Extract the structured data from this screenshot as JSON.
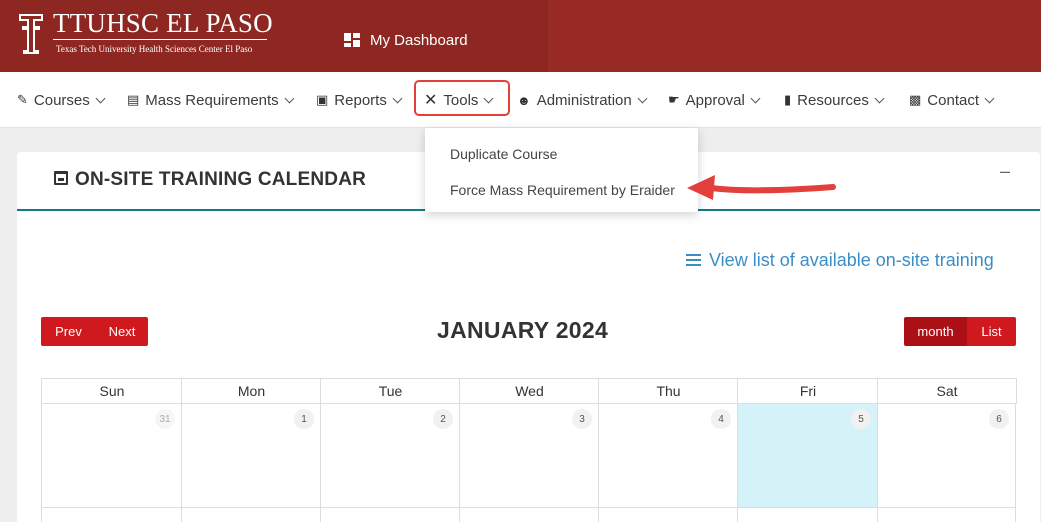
{
  "header": {
    "brand_title": "TTUHSC EL PASO",
    "brand_subtitle": "Texas Tech University Health Sciences Center El Paso",
    "dashboard_label": "My Dashboard",
    "colors": {
      "primary": "#8e2722",
      "accent": "#d0181f"
    }
  },
  "nav": {
    "items": [
      {
        "label": "Courses",
        "icon": "book-icon"
      },
      {
        "label": "Mass Requirements",
        "icon": "clipboard-icon"
      },
      {
        "label": "Reports",
        "icon": "report-icon"
      },
      {
        "label": "Tools",
        "icon": "tools-icon"
      },
      {
        "label": "Administration",
        "icon": "users-icon"
      },
      {
        "label": "Approval",
        "icon": "handshake-icon"
      },
      {
        "label": "Resources",
        "icon": "library-icon"
      },
      {
        "label": "Contact",
        "icon": "contact-card-icon"
      }
    ]
  },
  "tools_menu": {
    "items": [
      "Duplicate Course",
      "Force Mass Requirement by Eraider"
    ]
  },
  "card": {
    "title": "ON-SITE TRAINING CALENDAR",
    "minimize": "–",
    "view_list_label": "View list of available on-site training"
  },
  "calendar": {
    "prev_label": "Prev",
    "next_label": "Next",
    "month_label": "month",
    "list_label": "List",
    "title": "JANUARY 2024",
    "weekdays": [
      "Sun",
      "Mon",
      "Tue",
      "Wed",
      "Thu",
      "Fri",
      "Sat"
    ],
    "week1": [
      "31",
      "1",
      "2",
      "3",
      "4",
      "5",
      "6"
    ],
    "today": "5"
  }
}
